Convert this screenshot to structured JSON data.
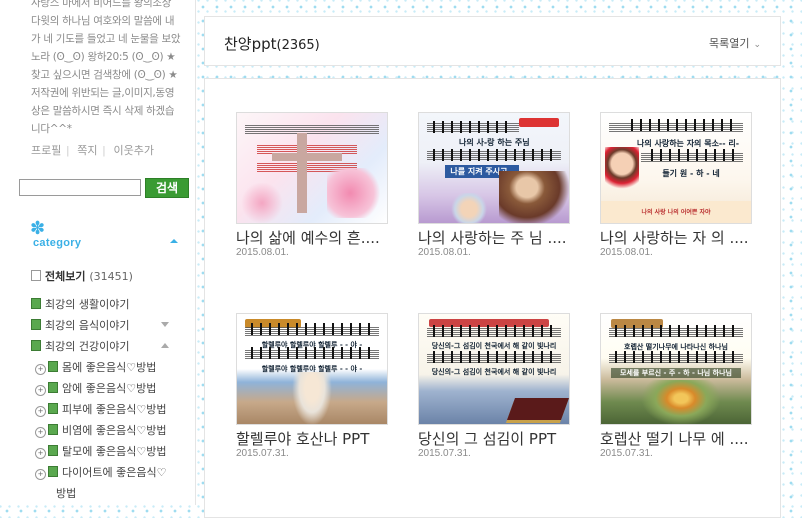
{
  "sidebar": {
    "intro": "사랑스 마에서 비어드를 왕의조상 다윗의 하나님 여호와의 말씀에 내가 네 기도를 들었고 네 눈물을 보았노라 (ʘ‿ʘ) 왕하20:5 (ʘ‿ʘ) ★찾고 싶으시면 검색창에 (ʘ‿ʘ) ★ 저작권에 위반되는 글,이미지,동영상은 말씀하시면 즉시 삭제 하겠습니다^^*",
    "profile_links": [
      "프로필",
      "쪽지",
      "이웃추가"
    ],
    "search_button": "검색",
    "search_value": "",
    "category_title": "category",
    "total_label": "전체보기",
    "total_count": "(31451)",
    "items": [
      {
        "label": "최강의 생활이야기",
        "arrow": "down"
      },
      {
        "label": "최강의 음식이야기",
        "arrow": "down"
      },
      {
        "label": "최강의 건강이야기",
        "arrow": "up"
      }
    ],
    "subitems": [
      "몸에 좋은음식♡방법",
      "암에 좋은음식♡방법",
      "피부에 좋은음식♡방법",
      "비염에 좋은음식♡방법",
      "탈모에 좋은음식♡방법",
      "다이어트에 좋은음식♡"
    ],
    "subitem_wrap": "방법"
  },
  "header": {
    "title": "찬양ppt",
    "count": "(2365)",
    "list_toggle": "목록열기"
  },
  "posts": [
    {
      "title": "나의 삶에 예수의 흔....",
      "date": "2015.08.01."
    },
    {
      "title": "나의 사랑하는 주 님 ....",
      "date": "2015.08.01."
    },
    {
      "title": "나의 사랑하는 자 의 ....",
      "date": "2015.08.01."
    },
    {
      "title": "할렐루야 호산나 PPT",
      "date": "2015.07.31."
    },
    {
      "title": "당신의 그 섬김이 PPT",
      "date": "2015.07.31."
    },
    {
      "title": "호렙산 떨기 나무 에 ....",
      "date": "2015.07.31."
    }
  ],
  "thumbs": [
    {
      "lyric1": "",
      "lyric2": ""
    },
    {
      "lyric1": "나의 사-랑 하는 주님",
      "lyric2": "나를 지켜 주시고 -"
    },
    {
      "lyric1": "나의 사랑하는 자의 목소-- 리-",
      "lyric2": "들기 원 - 하 - 네"
    },
    {
      "lyric1": "할렐루야 할렐루야 할렐루 - - 야 -",
      "lyric2": "할렐루야 할렐루야 할렐루 - - 야 -"
    },
    {
      "lyric1": "당신의-그 섬김이 천국에서 해 같이 빛나리",
      "lyric2": "당신의-그 섬김이 천국에서 해 같이 빛나리"
    },
    {
      "lyric1": "호렙산 떨기나무에 나타나신 하나님",
      "lyric2": "모세를 부르신 - 주 - 하 - 나님 하나님"
    }
  ],
  "colors": {
    "accent": "#3ab0e6",
    "search": "#3a9b33"
  }
}
